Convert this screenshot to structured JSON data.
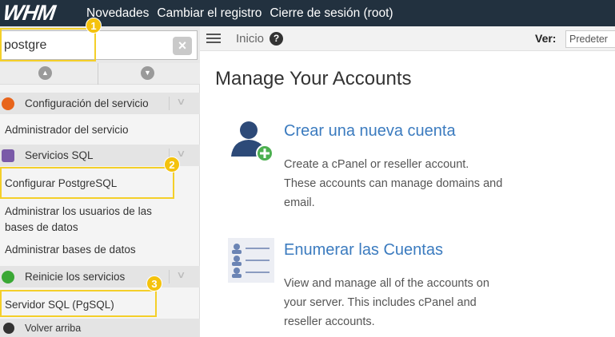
{
  "app": {
    "logo": "WHM"
  },
  "topnav": {
    "items": [
      "Novedades",
      "Cambiar el registro",
      "Cierre de sesión (root)"
    ]
  },
  "search": {
    "value": "postgre",
    "clear_icon": "×"
  },
  "annotations": [
    "1",
    "2",
    "3"
  ],
  "sidebar": {
    "sections": [
      {
        "label": "Configuración del servicio",
        "icon": "wrench-icon",
        "color": "#e8641b"
      },
      {
        "label": "Servicios SQL",
        "icon": "database-icon",
        "color": "#7a5aa8"
      },
      {
        "label": "Reinicie los servicios",
        "icon": "restart-icon",
        "color": "#3aa835"
      }
    ],
    "items": [
      "Administrador del servicio",
      "Configurar PostgreSQL",
      "Administrar los usuarios de las bases de datos",
      "Administrar bases de datos",
      "Servidor SQL (PgSQL)"
    ],
    "back_to_top": "Volver arriba"
  },
  "breadcrumb": {
    "home": "Inicio",
    "view_label": "Ver:",
    "view_value": "Predeter"
  },
  "main": {
    "title": "Manage Your Accounts",
    "features": [
      {
        "title": "Crear una nueva cuenta",
        "desc": "Create a cPanel or reseller account. These accounts can manage domains and email.",
        "icon": "add-user-icon"
      },
      {
        "title": "Enumerar las Cuentas",
        "desc": "View and manage all of the accounts on your server. This includes cPanel and reseller accounts.",
        "icon": "account-list-icon"
      }
    ]
  },
  "colors": {
    "topbar": "#22313f",
    "link": "#3b7bbf",
    "highlight": "#f4cf29"
  }
}
